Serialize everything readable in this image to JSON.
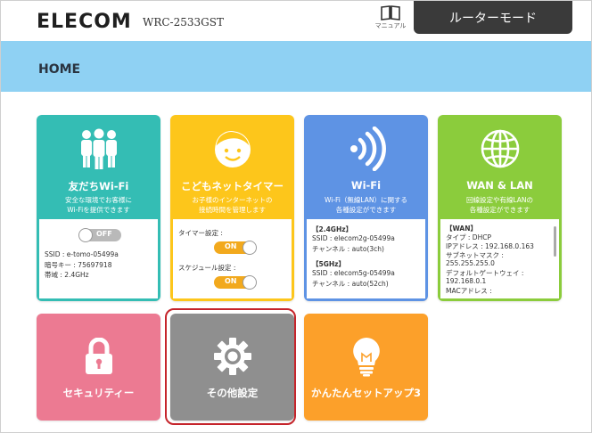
{
  "header": {
    "brand": "ELECOM",
    "model": "WRC-2533GST",
    "manual_label": "マニュアル",
    "mode_button": "ルーターモード"
  },
  "page": {
    "title": "HOME"
  },
  "tiles": {
    "friends_wifi": {
      "title": "友だちWi-Fi",
      "desc": [
        "安全な環境でお客様に",
        "Wi-Fiを提供できます"
      ],
      "toggle": "OFF",
      "lines": [
        "SSID : e-tomo-05499a",
        "暗号キー : 75697918",
        "帯域 : 2.4GHz"
      ],
      "color": "#34bdb4"
    },
    "kids_timer": {
      "title": "こどもネットタイマー",
      "desc": [
        "お子様のインターネットの",
        "接続時間を管理します"
      ],
      "timer_label": "タイマー設定 :",
      "timer_toggle": "ON",
      "schedule_label": "スケジュール設定 :",
      "schedule_toggle": "ON",
      "color": "#fdc61b"
    },
    "wifi": {
      "title": "Wi-Fi",
      "desc": [
        "Wi-Fi（無線LAN）に関する",
        "各種設定ができます"
      ],
      "band1": "【2.4GHz】",
      "band1_ssid": "SSID : elecom2g-05499a",
      "band1_channel": "チャンネル : auto(3ch)",
      "band2": "【5GHz】",
      "band2_ssid": "SSID : elecom5g-05499a",
      "band2_channel": "チャンネル : auto(52ch)",
      "color": "#5e93e4"
    },
    "wan_lan": {
      "title": "WAN & LAN",
      "desc": [
        "回線設定や有線LANの",
        "各種設定ができます"
      ],
      "wan_label": "【WAN】",
      "type": "タイプ : DHCP",
      "ip": "IPアドレス : 192.168.0.163",
      "subnet_label": "サブネットマスク :",
      "subnet": "255.255.255.0",
      "gateway_label": "デフォルトゲートウェイ :",
      "gateway": "192.168.0.1",
      "mac_label": "MACアドレス :",
      "color": "#8bcc3c"
    },
    "security": {
      "title": "セキュリティー",
      "color": "#ec7a92"
    },
    "other": {
      "title": "その他設定",
      "color": "#8f8f8f"
    },
    "easy_setup": {
      "title": "かんたんセットアップ3",
      "color": "#fca02a"
    }
  },
  "colors": {
    "home_bar": "#8fd1f3",
    "highlight": "#c5242b",
    "toggle_on": "#f2a91d",
    "toggle_off": "#b9b9b9"
  }
}
